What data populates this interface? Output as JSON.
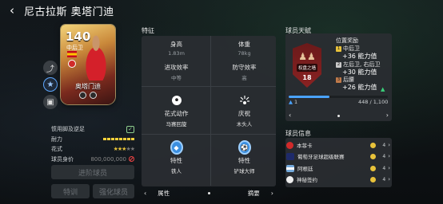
{
  "header": {
    "title": "尼古拉斯 奥塔门迪"
  },
  "card": {
    "rating": "140",
    "position": "中后卫",
    "name": "奥塔门迪"
  },
  "attributes": {
    "foot_label": "惯用脚及逆足",
    "stamina_label": "耐力",
    "skill_label": "花式",
    "value_label": "球员身价",
    "value": "800,000,000",
    "skill_stars": 3
  },
  "buttons": {
    "promote": "进阶球员",
    "train": "特训",
    "strengthen": "强化球员"
  },
  "traits": {
    "title": "特征",
    "height_label": "身高",
    "height_value": "1.83m",
    "weight_label": "体重",
    "weight_value": "78kg",
    "attack_label": "进攻效率",
    "attack_value": "中等",
    "defense_label": "防守效率",
    "defense_value": "高",
    "move_label": "花式动作",
    "move_value": "马赛回旋",
    "celebrate_label": "庆祝",
    "celebrate_value": "木头人",
    "trait1_label": "特性",
    "trait1_value": "铁人",
    "trait2_label": "特性",
    "trait2_value": "铲球大师",
    "tab_left": "属性",
    "tab_right": "摘要"
  },
  "talent": {
    "title": "球员天赋",
    "bonus_title": "位置奖励",
    "badge_tag": "权盘之墙",
    "level": "18",
    "rows": [
      {
        "num": "1",
        "pos": "中后卫",
        "bonus": "+36 能力值"
      },
      {
        "num": "2",
        "pos": "左后卫, 右后卫",
        "bonus": "+30 能力值"
      },
      {
        "num": "3",
        "pos": "后腰",
        "bonus": "+26 能力值"
      }
    ],
    "progress_level": "1",
    "progress_text": "448 / 1,100",
    "progress_fraction": 0.41
  },
  "info": {
    "title": "球员信息",
    "rows": [
      {
        "name": "本菲卡",
        "count": "4"
      },
      {
        "name": "葡萄牙足球超级联赛",
        "count": "4"
      },
      {
        "name": "阿根廷",
        "count": "4"
      },
      {
        "name": "神秘签约",
        "count": "4"
      }
    ]
  },
  "colors": {
    "accent": "#4aa3ff",
    "gold": "#ffd23a"
  }
}
